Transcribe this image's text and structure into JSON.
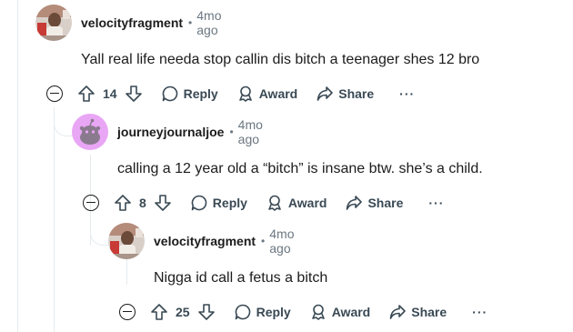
{
  "comments": [
    {
      "author": "velocityfragment",
      "time": "4mo ago",
      "text": "Yall real life needa stop callin dis bitch a teenager shes 12 bro",
      "score": "14",
      "reply_label": "Reply",
      "award_label": "Award",
      "share_label": "Share",
      "more_label": "···"
    },
    {
      "author": "journeyjournaljoe",
      "time": "4mo ago",
      "text": "calling a 12 year old a “bitch” is insane btw. she’s a child.",
      "score": "8",
      "reply_label": "Reply",
      "award_label": "Award",
      "share_label": "Share",
      "more_label": "···"
    },
    {
      "author": "velocityfragment",
      "time": "4mo ago",
      "text": "Nigga id call a fetus a bitch",
      "score": "25",
      "reply_label": "Reply",
      "award_label": "Award",
      "share_label": "Share",
      "more_label": "···"
    }
  ],
  "separator": "•",
  "colors": {
    "text": "#1c1c1c",
    "meta": "#6b7781",
    "thread": "#e5ebee",
    "snoo_bg": "#e9a6f5"
  }
}
